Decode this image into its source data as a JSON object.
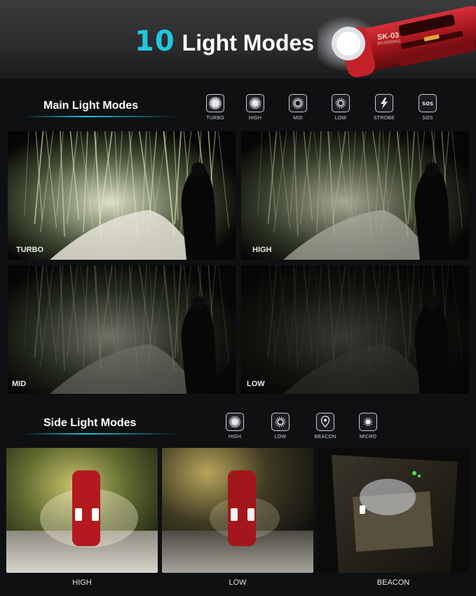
{
  "header": {
    "title_number": "10",
    "title_text": "Light Modes",
    "model_name": "SK-03",
    "model_serial": "SN:0000450"
  },
  "main_section": {
    "heading": "Main Light Modes",
    "modes": [
      {
        "label": "TURBO",
        "icon": "turbo-burst-icon"
      },
      {
        "label": "HIGH",
        "icon": "high-burst-icon"
      },
      {
        "label": "MID",
        "icon": "mid-burst-icon"
      },
      {
        "label": "LOW",
        "icon": "low-burst-icon"
      },
      {
        "label": "STROBE",
        "icon": "lightning-icon"
      },
      {
        "label": "SOS",
        "icon": "sos-icon"
      }
    ],
    "photos": [
      {
        "label": "TURBO",
        "brightness": 1.0
      },
      {
        "label": "HIGH",
        "brightness": 0.75
      },
      {
        "label": "MID",
        "brightness": 0.5
      },
      {
        "label": "LOW",
        "brightness": 0.25
      }
    ]
  },
  "side_section": {
    "heading": "Side Light Modes",
    "modes": [
      {
        "label": "HIGH",
        "icon": "high-burst-icon"
      },
      {
        "label": "LOW",
        "icon": "low-burst-icon"
      },
      {
        "label": "BEACON",
        "icon": "location-pin-icon"
      },
      {
        "label": "MICRO",
        "icon": "micro-burst-icon"
      }
    ],
    "photos": [
      {
        "caption": "HIGH"
      },
      {
        "caption": "LOW"
      },
      {
        "caption": "BEACON"
      }
    ]
  },
  "colors": {
    "accent": "#21c7df",
    "flashlight_red": "#b3191f",
    "background": "#0e1012"
  }
}
